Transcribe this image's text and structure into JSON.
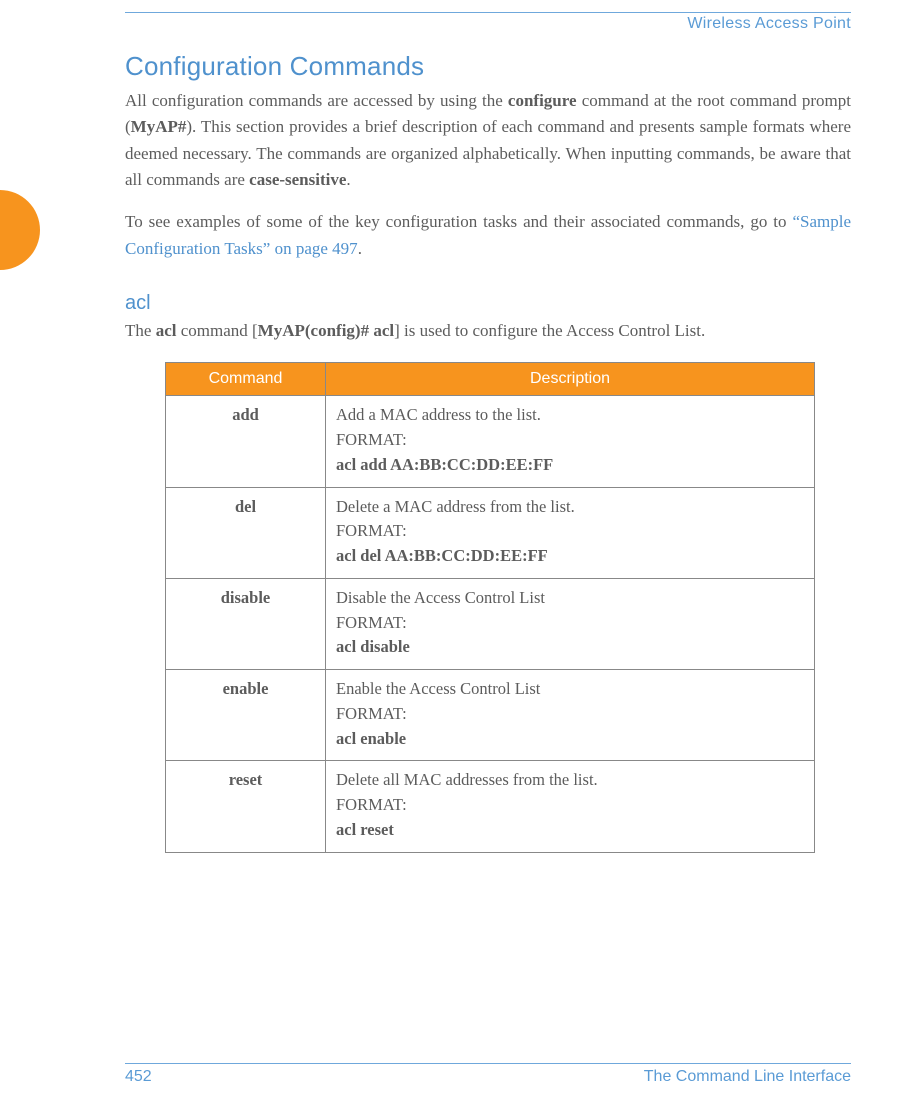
{
  "header": {
    "running_head": "Wireless Access Point"
  },
  "section": {
    "title": "Configuration Commands",
    "para1_pre": "All configuration commands are accessed by using the ",
    "para1_bold1": "configure",
    "para1_mid1": " command at the root command prompt (",
    "para1_bold2": "MyAP#",
    "para1_mid2": "). This section provides a brief description of each command and presents sample formats where deemed necessary. The commands are organized alphabetically. When inputting commands, be aware that all commands are ",
    "para1_bold3": "case-sensitive",
    "para1_post": ".",
    "para2_pre": "To see examples of some of the key configuration tasks and their associated commands, go to ",
    "para2_link": "“Sample Configuration Tasks” on page 497",
    "para2_post": "."
  },
  "subsection": {
    "title": "acl",
    "desc_pre": "The ",
    "desc_b1": "acl",
    "desc_mid1": " command [",
    "desc_b2": "MyAP(config)# acl",
    "desc_mid2": "] is used to configure the Access Control List."
  },
  "table": {
    "header_cmd": "Command",
    "header_desc": "Description",
    "rows": [
      {
        "cmd": "add",
        "line1": "Add a MAC address to the list.",
        "line2": "FORMAT:",
        "line3": "acl add AA:BB:CC:DD:EE:FF"
      },
      {
        "cmd": "del",
        "line1": "Delete a MAC address from the list.",
        "line2": "FORMAT:",
        "line3": "acl del AA:BB:CC:DD:EE:FF"
      },
      {
        "cmd": "disable",
        "line1": "Disable the Access Control List",
        "line2": "FORMAT:",
        "line3": "acl disable"
      },
      {
        "cmd": "enable",
        "line1": "Enable the Access Control List",
        "line2": "FORMAT:",
        "line3": "acl enable"
      },
      {
        "cmd": "reset",
        "line1": "Delete all MAC addresses from the list.",
        "line2": "FORMAT:",
        "line3": "acl reset"
      }
    ]
  },
  "footer": {
    "page": "452",
    "chapter": "The Command Line Interface"
  }
}
